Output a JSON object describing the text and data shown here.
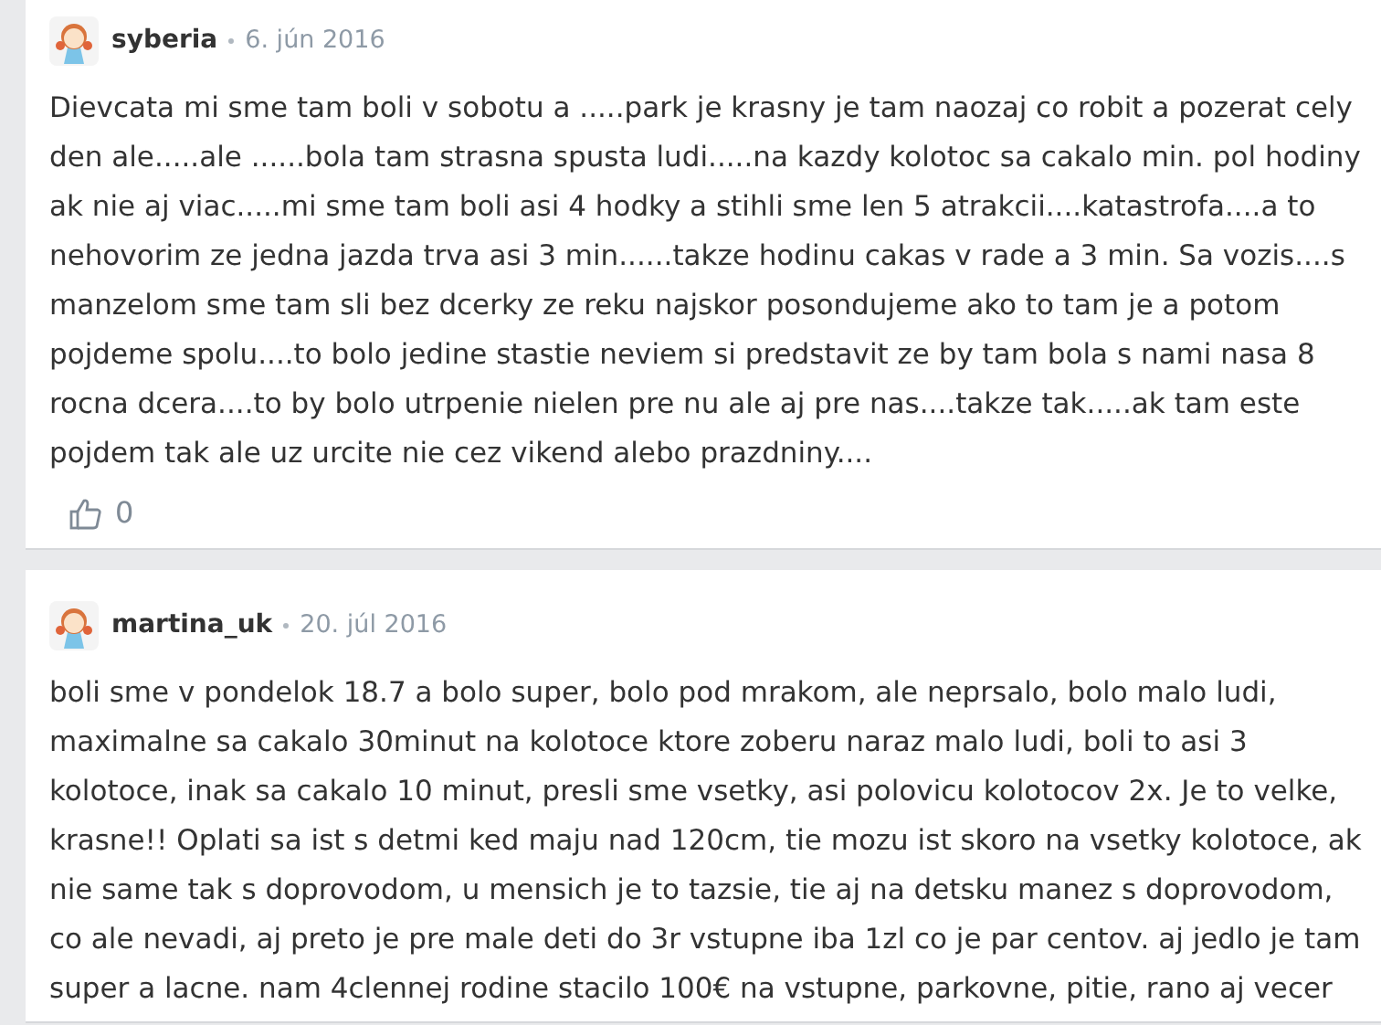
{
  "comments": [
    {
      "author": "syberia",
      "date": "6. jún 2016",
      "text": "Dievcata mi sme tam boli v sobotu a .....park je krasny je tam naozaj co robit a pozerat cely\nden ale.....ale ......bola tam strasna spusta ludi.....na kazdy kolotoc sa cakalo min. pol hodiny\nak nie aj viac.....mi sme tam boli asi 4 hodky a stihli sme len 5 atrakcii....katastrofa....a to\nnehovorim ze jedna jazda trva asi 3 min......takze hodinu cakas v rade a 3 min. Sa vozis....s\nmanzelom sme tam sli bez dcerky ze reku najskor posondujeme ako to tam je a potom\npojdeme spolu....to bolo jedine stastie neviem si predstavit ze by tam bola s nami nasa 8\nrocna dcera....to by bolo utrpenie nielen pre nu ale aj pre nas....takze tak.....ak tam este\npojdem tak ale uz urcite nie cez vikend alebo prazdniny....",
      "likes": "0"
    },
    {
      "author": "martina_uk",
      "date": "20. júl 2016",
      "text": "boli sme v pondelok 18.7 a bolo super, bolo pod mrakom, ale neprsalo, bolo malo ludi,\nmaximalne sa cakalo 30minut na kolotoce ktore zoberu naraz malo ludi, boli to asi 3\nkolotoce, inak sa cakalo 10 minut, presli sme vsetky, asi polovicu kolotocov 2x. Je to velke,\nkrasne!! Oplati sa ist s detmi ked maju nad 120cm, tie mozu ist skoro na vsetky kolotoce, ak\nnie same tak s doprovodom, u mensich je to tazsie, tie aj na detsku manez s doprovodom,\nco ale nevadi, aj preto je pre male deti do 3r vstupne iba 1zl co je par centov. aj jedlo je tam\nsuper a lacne. nam 4clennej rodine stacilo 100€ na vstupne, parkovne, pitie, rano aj vecer"
    }
  ]
}
